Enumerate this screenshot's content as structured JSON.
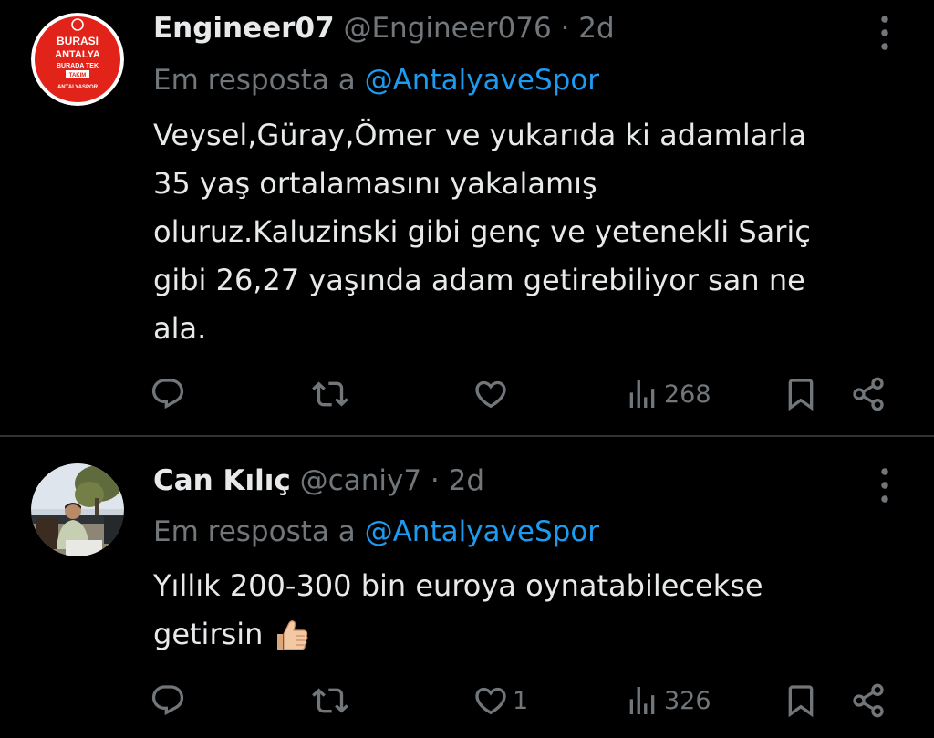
{
  "colors": {
    "background": "#000000",
    "text": "#e7e9ea",
    "muted": "#71767b",
    "mention": "#1d9bf0",
    "divider": "#2f3336"
  },
  "tweets": [
    {
      "name": "Engineer07",
      "handle": "@Engineer076",
      "separator": "·",
      "time": "2d",
      "reply_prefix": "Em resposta a",
      "reply_mention": "@AntalyaveSpor",
      "avatar": {
        "icon": "antalyaspor-logo",
        "lines": [
          "BURASI",
          "ANTALYA",
          "BURADA TEK",
          "TAKIM",
          "ANTALYASPOR"
        ]
      },
      "text_lines": [
        "Veysel,Güray,Ömer ve yukarıda ki adamlarla",
        "35 yaş ortalamasını yakalamış",
        "oluruz.Kaluzinski gibi genç ve yetenekli Sariç",
        "gibi 26,27 yaşında adam getirebiliyor san ne",
        "ala."
      ],
      "actions": {
        "reply_count": "",
        "retweet_count": "",
        "like_count": "",
        "views_count": "268"
      }
    },
    {
      "name": "Can Kılıç",
      "handle": "@caniy7",
      "separator": "·",
      "time": "2d",
      "reply_prefix": "Em resposta a",
      "reply_mention": "@AntalyaveSpor",
      "avatar": {
        "icon": "profile-photo"
      },
      "text_lines": [
        "Yıllık 200-300 bin euroya oynatabilecekse",
        "getirsin"
      ],
      "emoji": "thumbs-up",
      "actions": {
        "reply_count": "",
        "retweet_count": "",
        "like_count": "1",
        "views_count": "326"
      }
    }
  ]
}
